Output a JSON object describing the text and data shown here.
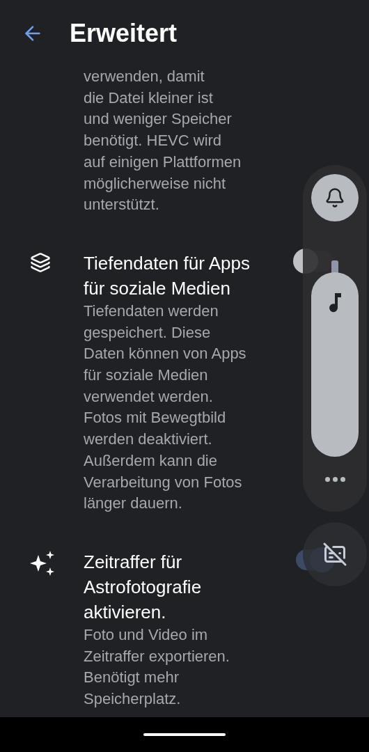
{
  "header": {
    "title": "Erweitert"
  },
  "settings": [
    {
      "kind": "continued",
      "description": "verwenden, damit\ndie Datei kleiner ist\nund weniger Speicher\nbenötigt. HEVC wird\nauf einigen Plattformen\nmöglicherweise nicht\nunterstützt."
    },
    {
      "kind": "depth",
      "title": "Tiefendaten für Apps\nfür soziale Medien",
      "description": "Tiefendaten werden\ngespeichert. Diese\nDaten können von Apps\nfür soziale Medien\nverwendet werden.\nFotos mit Bewegtbild\nwerden deaktiviert.\nAußerdem kann die\nVerarbeitung von Fotos\nlänger dauern.",
      "on": false
    },
    {
      "kind": "astro",
      "title": "Zeitraffer für\nAstrofotografie\naktivieren.",
      "description": "Foto und Video im\nZeitraffer exportieren.\nBenötigt mehr\nSpeicherplatz.",
      "on": true
    }
  ],
  "volume_panel": {
    "level": 1
  }
}
